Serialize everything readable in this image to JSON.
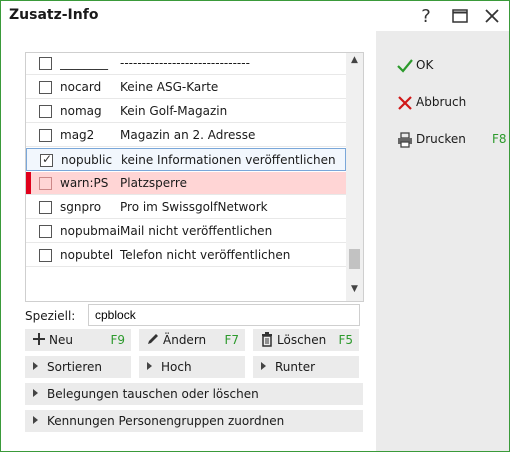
{
  "window": {
    "title": "Zusatz-Info"
  },
  "titlebar": {
    "help_label": "?"
  },
  "list": {
    "rows": [
      {
        "code": "________",
        "desc": "------------------------------",
        "checked": false
      },
      {
        "code": "nocard",
        "desc": "Keine ASG-Karte",
        "checked": false
      },
      {
        "code": "nomag",
        "desc": "Kein Golf-Magazin",
        "checked": false
      },
      {
        "code": "mag2",
        "desc": "Magazin an 2. Adresse",
        "checked": false
      },
      {
        "code": "nopublic",
        "desc": "keine Informationen veröffentlichen",
        "checked": true
      },
      {
        "code": "warn:PS",
        "desc": "Platzsperre",
        "checked": false
      },
      {
        "code": "sgnpro",
        "desc": "Pro im SwissgolfNetwork",
        "checked": false
      },
      {
        "code": "nopubmai",
        "desc": "Mail nicht veröffentlichen",
        "checked": false
      },
      {
        "code": "nopubtel",
        "desc": "Telefon nicht veröffentlichen",
        "checked": false
      }
    ]
  },
  "speziell": {
    "label": "Speziell:",
    "value": "cpblock"
  },
  "buttons": {
    "neu": {
      "label": "Neu",
      "key": "F9"
    },
    "aendern": {
      "label": "Ändern",
      "key": "F7"
    },
    "loeschen": {
      "label": "Löschen",
      "key": "F5"
    },
    "sortieren": {
      "label": "Sortieren"
    },
    "hoch": {
      "label": "Hoch"
    },
    "runter": {
      "label": "Runter"
    },
    "belegungen": {
      "label": "Belegungen tauschen oder löschen"
    },
    "kennungen": {
      "label": "Kennungen Personengruppen zuordnen"
    }
  },
  "side": {
    "ok": {
      "label": "OK"
    },
    "abbruch": {
      "label": "Abbruch"
    },
    "drucken": {
      "label": "Drucken",
      "key": "F8"
    }
  },
  "colors": {
    "accent_green": "#2c9a2c",
    "warn_red": "#e0001b",
    "warn_bg": "#ffd5d5",
    "border_green": "#3a9a3a"
  }
}
